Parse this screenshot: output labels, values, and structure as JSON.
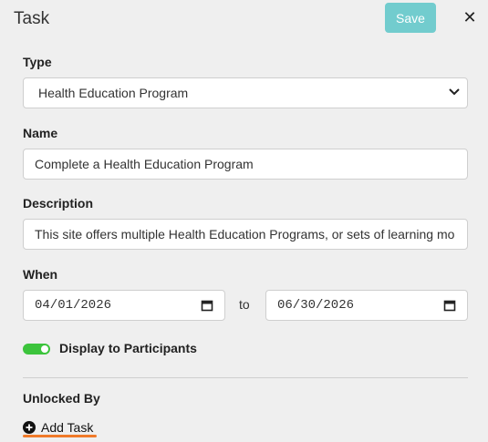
{
  "dialog": {
    "title": "Task"
  },
  "header": {
    "save_label": "Save",
    "close_glyph": "✕"
  },
  "type": {
    "label": "Type",
    "selected": "Health Education Program"
  },
  "name": {
    "label": "Name",
    "value": "Complete a Health Education Program"
  },
  "description": {
    "label": "Description",
    "value": "This site offers multiple Health Education Programs, or sets of learning mo"
  },
  "when": {
    "label": "When",
    "start": "04/01/2026",
    "separator": "to",
    "end": "06/30/2026"
  },
  "display": {
    "label": "Display to Participants",
    "enabled": true
  },
  "unlocked": {
    "label": "Unlocked By",
    "add_label": "Add Task"
  },
  "colors": {
    "save_bg": "#72ccce",
    "toggle_on": "#3cc43c",
    "underline": "#f07a2a"
  },
  "icons": {
    "close": "close-icon",
    "select": "chevron-down-icon",
    "calendar": "calendar-icon",
    "add": "plus-circle-icon"
  }
}
